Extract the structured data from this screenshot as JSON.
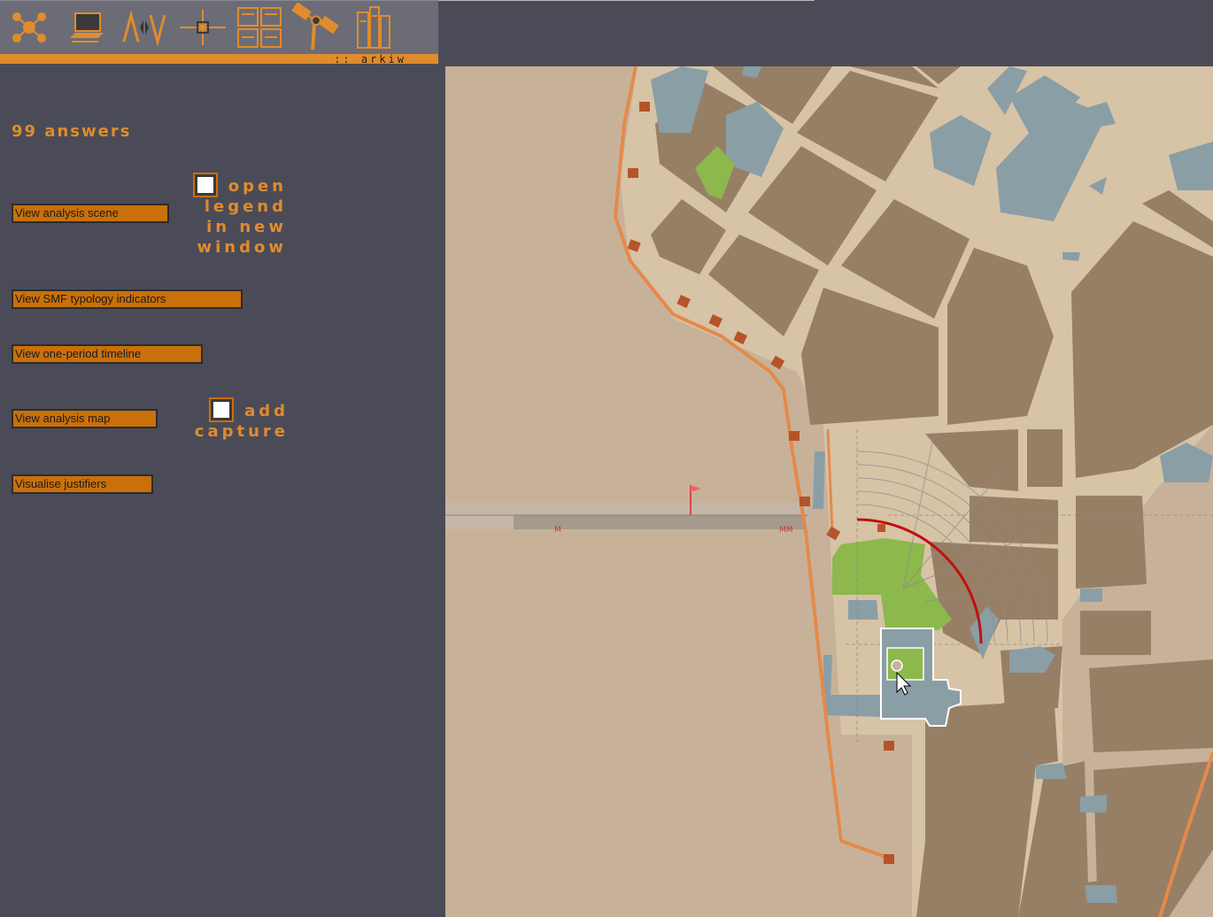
{
  "toolbar": {
    "tools": [
      "network-icon",
      "computer-icon",
      "compare-icon",
      "crosshair-icon",
      "layout-grid-icon",
      "satellite-icon",
      "archive-shelf-icon"
    ],
    "brand": ":: arkiw"
  },
  "panel": {
    "answers_count": "99 answers",
    "buttons": {
      "analysis_scene": "View analysis scene",
      "smf_typology": "View SMF typology indicators",
      "one_period_timeline": "View one-period timeline",
      "analysis_map": "View analysis map",
      "visualise_justifiers": "Visualise justifiers"
    },
    "checkboxes": {
      "open_legend": {
        "label_lines": [
          "open",
          "legend",
          "in new",
          "window"
        ],
        "checked": false
      },
      "add_capture": {
        "label_lines": [
          "add",
          "capture"
        ],
        "checked": false
      }
    }
  },
  "map": {
    "timeline_labels": [
      "M",
      "MM"
    ],
    "colors": {
      "ground": "#c7b299",
      "building": "#977f66",
      "roads": "#d7c3a6",
      "water_blue": "#8a9ea6",
      "park_green": "#8cb84c",
      "route_orange": "#e58a4a",
      "marker_brown": "#b5542a",
      "arc_red": "#c01010"
    }
  }
}
